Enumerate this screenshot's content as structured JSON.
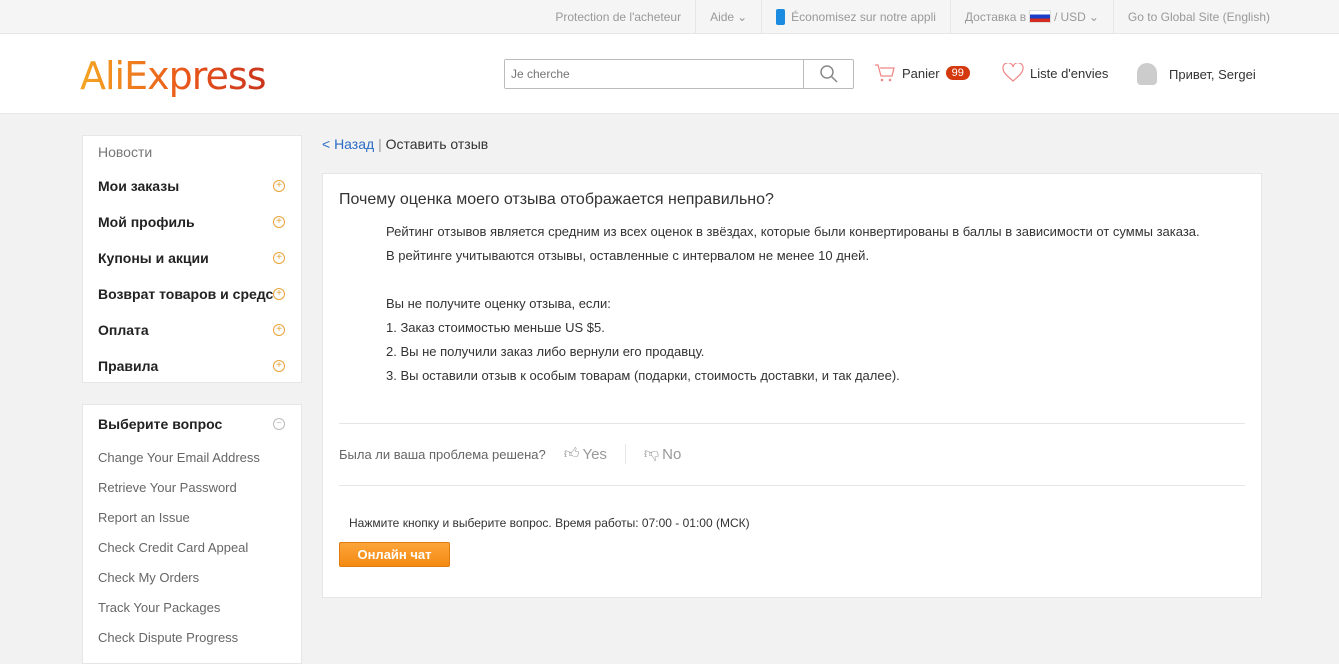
{
  "topbar": {
    "protection": "Protection de l'acheteur",
    "help": "Aide",
    "app": "Économisez sur notre appli",
    "delivery": "Доставка в",
    "currency": "USD",
    "global": "Go to Global Site (English)"
  },
  "header": {
    "logo": "AliExpress",
    "search_placeholder": "Je cherche",
    "cart": "Panier",
    "cart_count": "99",
    "wishlist": "Liste d'envies",
    "greeting": "Привет, Sergei"
  },
  "sidebar": {
    "news": "Новости",
    "items": [
      {
        "label": "Мои заказы"
      },
      {
        "label": "Мой профиль"
      },
      {
        "label": "Купоны и акции"
      },
      {
        "label": "Возврат товаров и средств"
      },
      {
        "label": "Оплата"
      },
      {
        "label": "Правила"
      }
    ]
  },
  "questions": {
    "title": "Выберите вопрос",
    "items": [
      "Change Your Email Address",
      "Retrieve Your Password",
      "Report an Issue",
      "Check Credit Card Appeal",
      "Check My Orders",
      "Track Your Packages",
      "Check Dispute Progress"
    ]
  },
  "breadcrumb": {
    "back": "< Назад",
    "sep": "|",
    "current": "Оставить отзыв"
  },
  "article": {
    "title": "Почему оценка моего отзыва отображается неправильно?",
    "p1": "Рейтинг отзывов является средним из всех оценок в звёздах, которые были конвертированы в баллы в зависимости от суммы заказа. В рейтинге учитываются отзывы, оставленные с интервалом не менее 10 дней.",
    "p2": "Вы не получите оценку отзыва, если:",
    "l1": "1. Заказ стоимостью меньше US $5.",
    "l2": "2.  Вы не получили заказ либо вернули его продавцу.",
    "l3": "3. Вы оставили отзыв к особым товарам (подарки, стоимость доставки, и так далее)."
  },
  "feedback": {
    "question": "Была ли ваша проблема решена?",
    "yes": "Yes",
    "no": "No"
  },
  "chat": {
    "note": "Нажмите кнопку и выберите вопрос. Время работы: 07:00 - 01:00 (МСК)",
    "button": "Онлайн чат"
  }
}
